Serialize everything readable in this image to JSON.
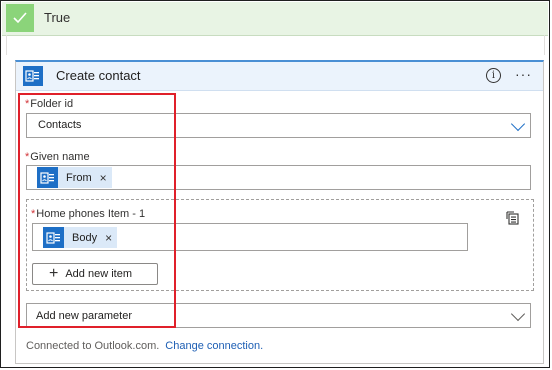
{
  "condition": {
    "label": "True",
    "accent": "#8bd47a"
  },
  "card": {
    "title": "Create contact",
    "info_glyph": "i",
    "more_glyph": "···",
    "app_icon": "outlook-contacts-icon",
    "accent": "#1e6fc6"
  },
  "fields": {
    "folder": {
      "label": "Folder id",
      "required": "*",
      "value": "Contacts"
    },
    "given_name": {
      "label": "Given name",
      "required": "*",
      "token": "From",
      "token_remove": "×"
    },
    "home_phones": {
      "label": "Home phones Item - 1",
      "required": "*",
      "token": "Body",
      "token_remove": "×"
    }
  },
  "add_item": {
    "plus": "+",
    "label": "Add new item"
  },
  "add_param": {
    "label": "Add new parameter"
  },
  "footer": {
    "connected": "Connected to Outlook.com.",
    "change": "Change connection."
  },
  "highlight_color": "#e0202a"
}
